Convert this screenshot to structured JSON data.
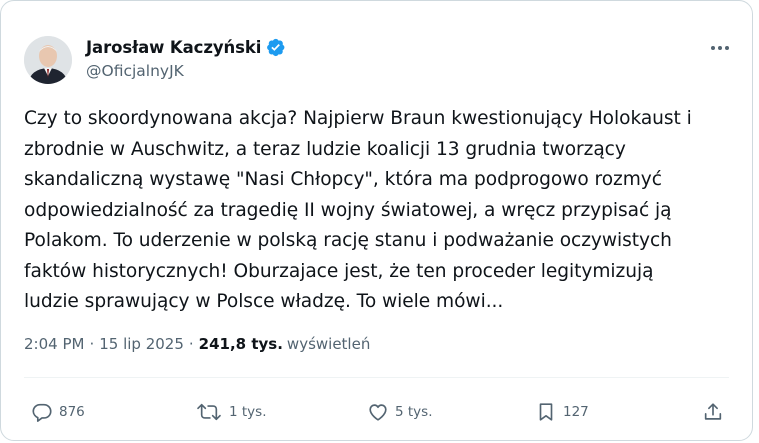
{
  "author": {
    "name": "Jarosław Kaczyński",
    "handle": "@OficjalnyJK",
    "verified": true
  },
  "tweet": {
    "text": "Czy to skoordynowana akcja? Najpierw Braun kwestionujący Holokaust i\nzbrodnie w Auschwitz, a teraz ludzie koalicji 13 grudnia tworzący\nskandaliczną wystawę \"Nasi Chłopcy\", która ma podprogowo rozmyć\nodpowiedzialność za tragedię II wojny światowej, a wręcz przypisać ją\nPolakom. To uderzenie w polską rację stanu i podważanie oczywistych\nfaktów historycznych! Oburzajace jest, że ten proceder legitymizują\nludzie sprawujący w Polsce władzę. To wiele mówi...",
    "time": "2:04 PM",
    "date": "15 lip 2025",
    "views": "241,8 tys.",
    "views_label": "wyświetleń",
    "meta_sep": "·"
  },
  "actions": {
    "reply_count": "876",
    "repost_count": "1 tys.",
    "like_count": "5 tys.",
    "bookmark_count": "127"
  },
  "colors": {
    "verified": "#1d9bf0",
    "secondary_text": "#536471",
    "primary_text": "#0f1419",
    "border": "#cfd9de"
  },
  "icons": {
    "more": "more-horizontal-icon",
    "reply": "reply-icon",
    "repost": "repost-icon",
    "like": "heart-icon",
    "bookmark": "bookmark-icon",
    "share": "share-icon",
    "verified": "verified-badge-icon"
  }
}
